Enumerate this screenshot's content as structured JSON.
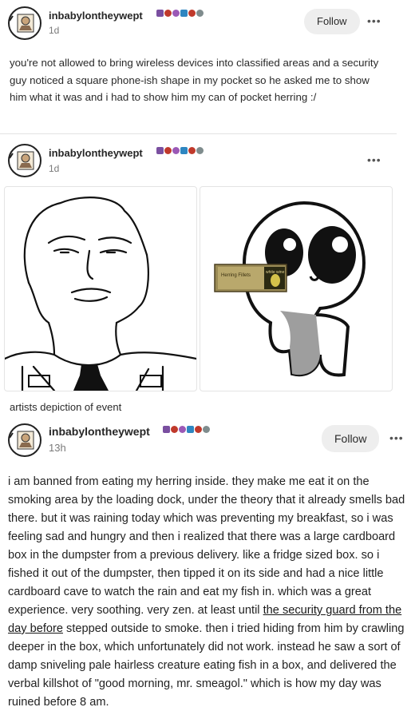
{
  "post1": {
    "username": "inbabylontheywept",
    "time": "1d",
    "follow_label": "Follow",
    "more_label": "•••",
    "text": "you're not allowed to bring wireless devices into classified areas and a security guy noticed a square phone-ish shape in my pocket so he asked me to show him what it was and i had to show him my can of pocket herring :/"
  },
  "post2": {
    "username": "inbabylontheywept",
    "time": "1d",
    "more_label": "•••",
    "caption": "artists depiction of event",
    "can_label_left": "Herring Fillets",
    "can_label_right": "white wine"
  },
  "post3": {
    "username": "inbabylontheywept",
    "time": "13h",
    "follow_label": "Follow",
    "more_label": "•••",
    "text_before_link": "i am banned from eating my herring inside. they make me eat it on the smoking area by the loading dock, under the theory that it already smells bad there. but it was raining today which was preventing my breakfast, so i was feeling sad and hungry and then i realized that there was a large cardboard box in the dumpster from a previous delivery. like a fridge sized box. so i fished it out of the dumpster, then tipped it on its side and had a nice little cardboard cave to watch the rain and eat my fish in. which was a great experience. very soothing. very zen. at least until ",
    "link_text": "the security guard from the day before",
    "text_after_link": " stepped outside to smoke. then i tried hiding from him by crawling deeper in the box, which unfortunately did not work. instead he saw a sort of damp sniveling pale hairless creature eating fish in a box, and delivered the verbal killshot of \"good morning, mr. smeagol.\" which is how my day was ruined before 8 am."
  },
  "badge_colors": [
    "#7a4fa0",
    "#c0392b",
    "#9b59b6",
    "#2e86c1",
    "#c0392b",
    "#7f8c8d"
  ],
  "accent": {
    "reblog_green": "#2dbd6a",
    "follow_bg": "#eeeeee"
  }
}
